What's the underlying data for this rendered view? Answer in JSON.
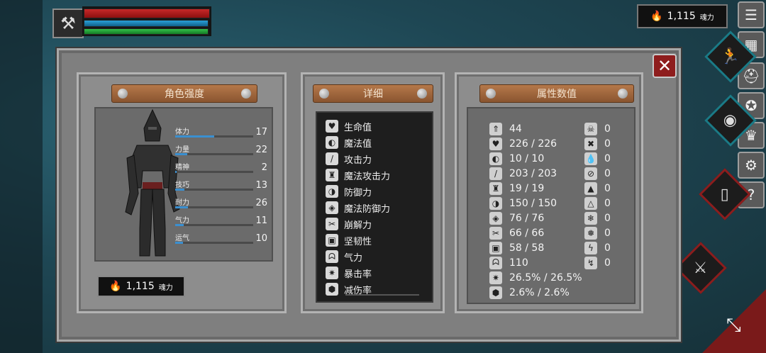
{
  "hud": {
    "soul_amount": "1,115",
    "soul_unit": "魂力"
  },
  "window": {
    "sections": {
      "strength": "角色强度",
      "details": "详细",
      "attributes": "属性数值"
    },
    "stats": [
      {
        "label": "体力",
        "value": "17",
        "level": 0.5
      },
      {
        "label": "力量",
        "value": "22",
        "level": 0.15
      },
      {
        "label": "精神",
        "value": "2",
        "level": 0.02
      },
      {
        "label": "技巧",
        "value": "13",
        "level": 0.12
      },
      {
        "label": "耐力",
        "value": "26",
        "level": 0.16
      },
      {
        "label": "气力",
        "value": "11",
        "level": 0.11
      },
      {
        "label": "运气",
        "value": "10",
        "level": 0.1
      }
    ],
    "soul_button": {
      "amount": "1,115",
      "unit": "魂力"
    },
    "details": [
      {
        "label": "生命值",
        "icon": "heart-icon"
      },
      {
        "label": "魔法值",
        "icon": "mana-icon"
      },
      {
        "label": "攻击力",
        "icon": "sword-icon"
      },
      {
        "label": "魔法攻击力",
        "icon": "magic-attack-icon"
      },
      {
        "label": "防御力",
        "icon": "shield-icon"
      },
      {
        "label": "魔法防御力",
        "icon": "magic-shield-icon"
      },
      {
        "label": "崩解力",
        "icon": "break-icon"
      },
      {
        "label": "坚韧性",
        "icon": "helmet-icon"
      },
      {
        "label": "气力",
        "icon": "lungs-icon"
      },
      {
        "label": "暴击率",
        "icon": "crit-icon"
      },
      {
        "label": "减伤率",
        "icon": "reduction-icon"
      }
    ],
    "attributes_left": [
      {
        "icon": "level-icon",
        "value": "44"
      },
      {
        "icon": "heart-icon",
        "value": "226 / 226"
      },
      {
        "icon": "mana-icon",
        "value": "10 / 10"
      },
      {
        "icon": "sword-icon",
        "value": "203 / 203"
      },
      {
        "icon": "magic-attack-icon",
        "value": "19 / 19"
      },
      {
        "icon": "shield-icon",
        "value": "150 / 150"
      },
      {
        "icon": "magic-shield-icon",
        "value": "76 / 76"
      },
      {
        "icon": "break-icon",
        "value": "66 / 66"
      },
      {
        "icon": "helmet-icon",
        "value": "58 / 58"
      },
      {
        "icon": "lungs-icon",
        "value": "110"
      },
      {
        "icon": "crit-icon",
        "value": "26.5% / 26.5%"
      },
      {
        "icon": "reduction-icon",
        "value": "2.6% / 2.6%"
      }
    ],
    "attributes_right": [
      {
        "icon": "skull-icon",
        "value": "0"
      },
      {
        "icon": "bones-icon",
        "value": "0"
      },
      {
        "icon": "blood-icon",
        "value": "0"
      },
      {
        "icon": "poison-icon",
        "value": "0"
      },
      {
        "icon": "fire-icon",
        "value": "0"
      },
      {
        "icon": "fire-resist-icon",
        "value": "0"
      },
      {
        "icon": "frost-icon",
        "value": "0"
      },
      {
        "icon": "frost-resist-icon",
        "value": "0"
      },
      {
        "icon": "lightning-icon",
        "value": "0"
      },
      {
        "icon": "lightning-resist-icon",
        "value": "0"
      }
    ]
  }
}
